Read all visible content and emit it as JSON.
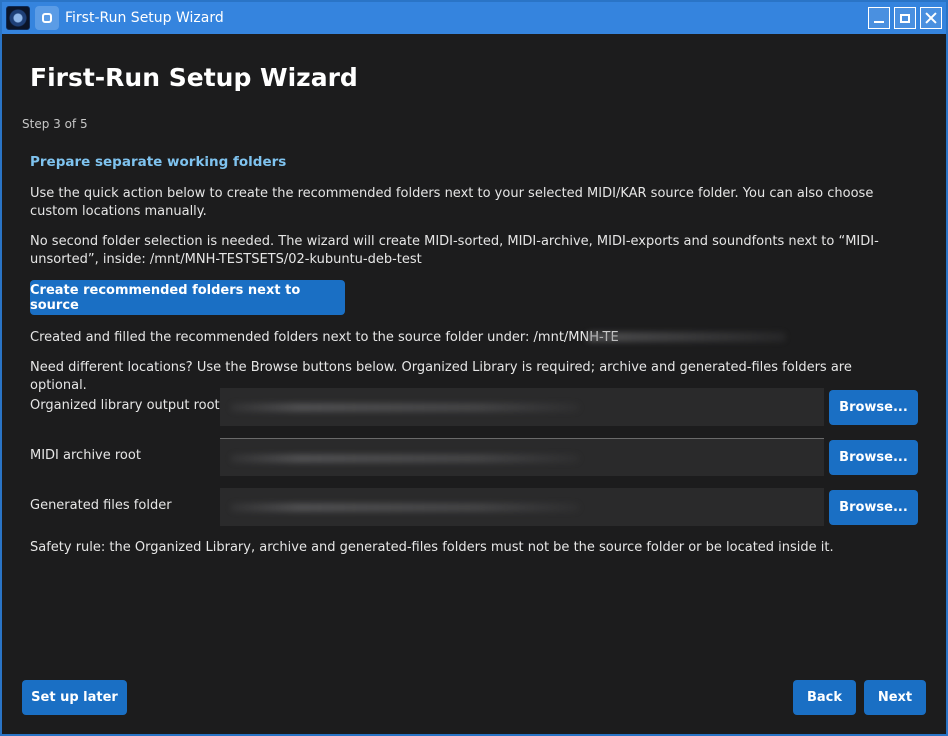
{
  "window": {
    "title": "First-Run Setup Wizard"
  },
  "wizard": {
    "heading": "First-Run Setup Wizard",
    "step": "Step 3 of 5",
    "section_title": "Prepare separate working folders",
    "intro": "Use the quick action below to create the recommended folders next to your selected MIDI/KAR source folder. You can also choose custom locations manually.",
    "note": "No second folder selection is needed. The wizard will create MIDI-sorted, MIDI-archive, MIDI-exports and soundfonts next to “MIDI-unsorted”, inside: /mnt/MNH-TESTSETS/02-kubuntu-deb-test",
    "create_button": "Create recommended folders next to source",
    "created_status": "Created and filled the recommended folders next to the source folder under: /mnt/MNH-TE",
    "custom_hint": "Need different locations? Use the Browse buttons below. Organized Library is required; archive and generated-files folders are optional.",
    "rows": [
      {
        "label": "Organized library output root",
        "value": "",
        "browse": "Browse..."
      },
      {
        "label": "MIDI archive root",
        "value": "",
        "browse": "Browse..."
      },
      {
        "label": "Generated files folder",
        "value": "",
        "browse": "Browse..."
      }
    ],
    "safety_rule": "Safety rule: the Organized Library, archive and generated-files folders must not be the source folder or be located inside it."
  },
  "footer": {
    "later": "Set up later",
    "back": "Back",
    "next": "Next"
  },
  "colors": {
    "accent": "#1a6fc4",
    "titlebar": "#3584de",
    "section_title": "#7fc3ef",
    "background": "#1c1c1d"
  }
}
